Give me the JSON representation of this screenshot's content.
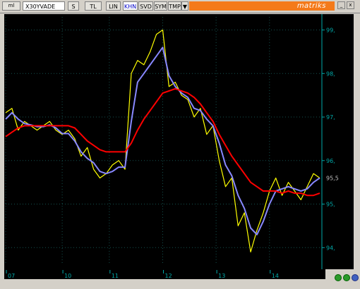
{
  "toolbar": {
    "logo_badge": "ml",
    "symbol": "X30YVADE",
    "buttons": [
      "S",
      "TL",
      "LIN",
      "KHN",
      "SVD",
      "SYM",
      "TMP"
    ],
    "active_button": "KHN",
    "dropdown_arrow": "▼",
    "brand": "matriks",
    "brand_color": "#f47a1a"
  },
  "window_controls": {
    "minimize": "_",
    "close": "x"
  },
  "colors": {
    "background": "#000000",
    "price": "#ffff00",
    "ma_short": "#8888ff",
    "ma_long": "#ff0000",
    "axis": "#00aaaa",
    "grid": "#14504e"
  },
  "chart_data": {
    "type": "line",
    "x_labels": [
      "07",
      "10",
      "11",
      "12",
      "13",
      "14"
    ],
    "y_ticks": [
      94,
      95,
      96,
      97,
      98,
      99
    ],
    "y_tick_labels": [
      "94,",
      "95,",
      "96,",
      "97,",
      "98,",
      "99,"
    ],
    "last_value_label": "95,5",
    "ylim": [
      93.6,
      99.3
    ],
    "xlim": [
      0,
      100
    ],
    "series": [
      {
        "role": "price",
        "color": "#ffff00",
        "x": [
          0,
          2,
          4,
          6,
          8,
          10,
          12,
          14,
          16,
          18,
          20,
          22,
          24,
          26,
          28,
          30,
          32,
          34,
          36,
          38,
          40,
          42,
          44,
          46,
          48,
          50,
          52,
          54,
          56,
          58,
          60,
          62,
          64,
          66,
          68,
          70,
          72,
          74,
          76,
          78,
          80,
          82,
          84,
          86,
          88,
          90,
          92,
          94,
          96,
          98,
          100
        ],
        "y": [
          97.1,
          97.2,
          96.7,
          96.9,
          96.8,
          96.7,
          96.8,
          96.9,
          96.7,
          96.6,
          96.7,
          96.5,
          96.1,
          96.3,
          95.8,
          95.6,
          95.7,
          95.9,
          96.0,
          95.8,
          98.0,
          98.3,
          98.2,
          98.5,
          98.9,
          99.0,
          97.7,
          97.8,
          97.5,
          97.4,
          97.0,
          97.2,
          96.6,
          96.8,
          96.0,
          95.4,
          95.6,
          94.5,
          94.8,
          93.9,
          94.4,
          94.8,
          95.3,
          95.6,
          95.2,
          95.5,
          95.3,
          95.1,
          95.4,
          95.7,
          95.6
        ]
      },
      {
        "role": "short_ma",
        "color": "#8888ff",
        "x": [
          0,
          2,
          4,
          6,
          8,
          10,
          12,
          14,
          16,
          18,
          20,
          22,
          24,
          26,
          28,
          30,
          32,
          34,
          36,
          38,
          40,
          42,
          44,
          46,
          48,
          50,
          52,
          54,
          56,
          58,
          60,
          62,
          64,
          66,
          68,
          70,
          72,
          74,
          76,
          78,
          80,
          82,
          84,
          86,
          88,
          90,
          92,
          94,
          96,
          98,
          100
        ],
        "y": [
          96.95,
          97.1,
          96.95,
          96.85,
          96.82,
          96.78,
          96.78,
          96.82,
          96.75,
          96.62,
          96.62,
          96.45,
          96.2,
          96.05,
          95.95,
          95.75,
          95.7,
          95.75,
          95.85,
          95.85,
          96.9,
          97.8,
          98.0,
          98.2,
          98.4,
          98.6,
          97.95,
          97.7,
          97.55,
          97.45,
          97.2,
          97.15,
          96.95,
          96.8,
          96.4,
          95.9,
          95.65,
          95.2,
          94.9,
          94.45,
          94.3,
          94.6,
          95.0,
          95.3,
          95.35,
          95.4,
          95.35,
          95.3,
          95.35,
          95.5,
          95.6
        ]
      },
      {
        "role": "long_ma",
        "color": "#ff0000",
        "x": [
          0,
          2,
          4,
          6,
          8,
          10,
          12,
          14,
          16,
          18,
          20,
          22,
          24,
          26,
          28,
          30,
          32,
          34,
          36,
          38,
          40,
          42,
          44,
          46,
          48,
          50,
          52,
          54,
          56,
          58,
          60,
          62,
          64,
          66,
          68,
          70,
          72,
          74,
          76,
          78,
          80,
          82,
          84,
          86,
          88,
          90,
          92,
          94,
          96,
          98,
          100
        ],
        "y": [
          96.55,
          96.65,
          96.75,
          96.8,
          96.8,
          96.8,
          96.8,
          96.8,
          96.8,
          96.8,
          96.8,
          96.75,
          96.6,
          96.45,
          96.35,
          96.25,
          96.2,
          96.2,
          96.2,
          96.2,
          96.4,
          96.7,
          96.95,
          97.15,
          97.35,
          97.55,
          97.6,
          97.65,
          97.6,
          97.55,
          97.45,
          97.3,
          97.1,
          96.9,
          96.6,
          96.35,
          96.1,
          95.9,
          95.7,
          95.5,
          95.4,
          95.3,
          95.3,
          95.3,
          95.25,
          95.3,
          95.25,
          95.25,
          95.2,
          95.2,
          95.25
        ]
      }
    ]
  }
}
